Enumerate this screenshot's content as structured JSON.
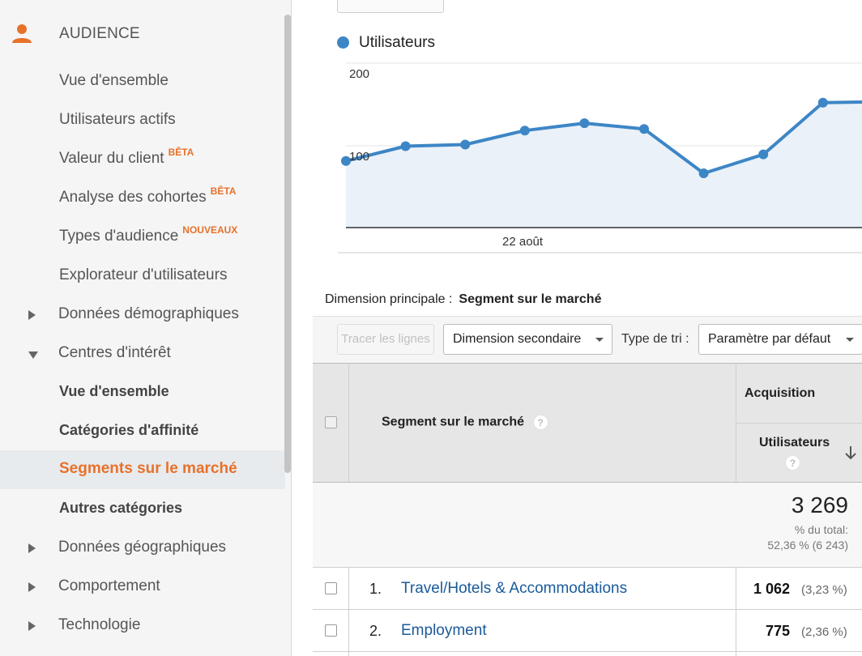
{
  "sidebar": {
    "section_label": "AUDIENCE",
    "items": [
      {
        "label": "Vue d'ensemble"
      },
      {
        "label": "Utilisateurs actifs"
      },
      {
        "label": "Valeur du client",
        "badge": "BÊTA"
      },
      {
        "label": "Analyse des cohortes",
        "badge": "BÊTA"
      },
      {
        "label": "Types d'audience",
        "badge": "NOUVEAUX"
      },
      {
        "label": "Explorateur d'utilisateurs"
      },
      {
        "label": "Données démographiques"
      },
      {
        "label": "Centres d'intérêt"
      },
      {
        "label": "Vue d'ensemble"
      },
      {
        "label": "Catégories d'affinité"
      },
      {
        "label": "Segments sur le marché"
      },
      {
        "label": "Autres catégories"
      },
      {
        "label": "Données géographiques"
      },
      {
        "label": "Comportement"
      },
      {
        "label": "Technologie"
      }
    ],
    "accent_color": "#e8712a"
  },
  "chart_legend": "Utilisateurs",
  "chart_data": {
    "type": "line",
    "series": [
      {
        "name": "Utilisateurs",
        "values": [
          81,
          99,
          101,
          118,
          127,
          120,
          66,
          89,
          152,
          153
        ]
      }
    ],
    "y_ticks": [
      "200",
      "100"
    ],
    "x_tick_label": "22 août",
    "ylim": [
      0,
      200
    ],
    "color": "#3d86c6"
  },
  "dimension": {
    "label": "Dimension principale :",
    "value": "Segment sur le marché"
  },
  "toolbar": {
    "plot_button": "Tracer les lignes",
    "secondary_dimension": "Dimension secondaire",
    "sort_label": "Type de tri :",
    "sort_value": "Paramètre par défaut"
  },
  "table": {
    "header_dimension": "Segment sur le marché",
    "group_header": "Acquisition",
    "metric_header": "Utilisateurs",
    "help_glyph": "?",
    "total_value": "3 269",
    "total_pct_label": "% du total:",
    "total_pct_value": "52,36 % (6 243)",
    "rows": [
      {
        "num": "1.",
        "label": "Travel/Hotels & Accommodations",
        "value": "1 062",
        "pct": "(3,23 %)"
      },
      {
        "num": "2.",
        "label": "Employment",
        "value": "775",
        "pct": "(2,36 %)"
      }
    ]
  }
}
